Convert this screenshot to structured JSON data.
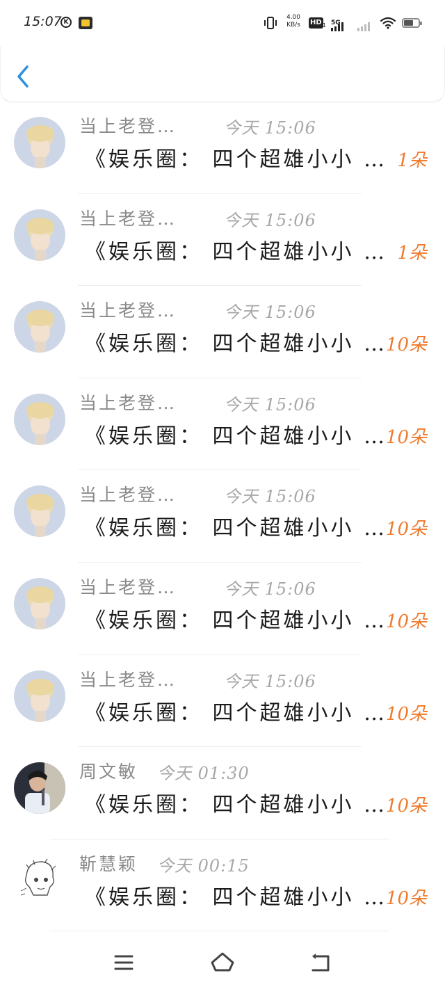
{
  "status_bar": {
    "time": "15:07",
    "net_speed_value": "4.00",
    "net_speed_unit": "KB/s",
    "hd_label": "HD",
    "hd_sub": "1",
    "network_label": "5G",
    "icons": [
      "k-badge-icon",
      "app-notification-icon",
      "vibrate-icon",
      "signal-icon",
      "wifi-icon",
      "battery-icon"
    ],
    "battery_level": 0.7
  },
  "header": {
    "back_icon": "chevron-left-icon",
    "accent_color": "#2f8fe0"
  },
  "colors": {
    "count": "#f07a2c",
    "name": "#8a8a8a",
    "time": "#a7a7a7",
    "preview": "#1b1b1b"
  },
  "messages": [
    {
      "name": "当上老登…",
      "time": "今天 15:06",
      "preview": "《娱乐圈：  四个超雄小小 …",
      "count": "1朵"
    },
    {
      "name": "当上老登…",
      "time": "今天 15:06",
      "preview": "《娱乐圈：  四个超雄小小 …",
      "count": "1朵"
    },
    {
      "name": "当上老登…",
      "time": "今天 15:06",
      "preview": "《娱乐圈：  四个超雄小小 …",
      "count": "10朵"
    },
    {
      "name": "当上老登…",
      "time": "今天 15:06",
      "preview": "《娱乐圈：  四个超雄小小 …",
      "count": "10朵"
    },
    {
      "name": "当上老登…",
      "time": "今天 15:06",
      "preview": "《娱乐圈：  四个超雄小小 …",
      "count": "10朵"
    },
    {
      "name": "当上老登…",
      "time": "今天 15:06",
      "preview": "《娱乐圈：  四个超雄小小 …",
      "count": "10朵"
    },
    {
      "name": "当上老登…",
      "time": "今天 15:06",
      "preview": "《娱乐圈：  四个超雄小小 …",
      "count": "10朵"
    },
    {
      "name": "周文敏",
      "time": "今天 01:30",
      "preview": "《娱乐圈：  四个超雄小小 …",
      "count": "10朵"
    },
    {
      "name": "靳慧颖",
      "time": "今天 00:15",
      "preview": "《娱乐圈：  四个超雄小小 …",
      "count": "10朵"
    }
  ],
  "nav_bar": {
    "icons": [
      "menu-icon",
      "home-icon",
      "back-icon"
    ]
  }
}
